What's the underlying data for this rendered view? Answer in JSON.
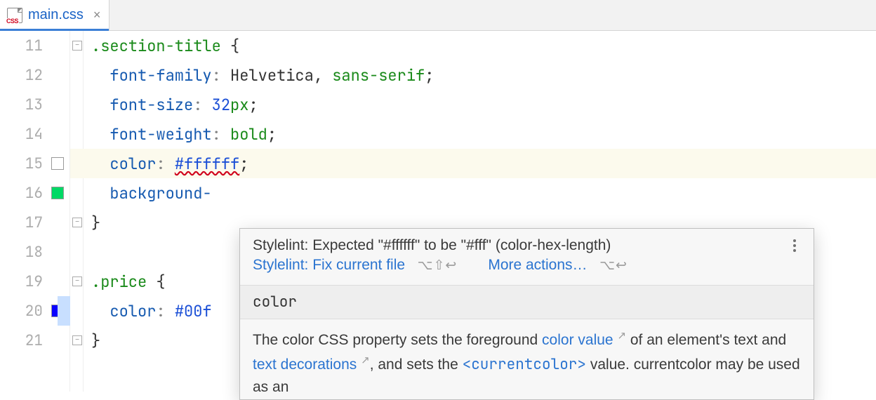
{
  "tab": {
    "filename": "main.css",
    "icon_badge": "CSS"
  },
  "gutter": {
    "start": 11,
    "end": 21,
    "swatches": {
      "15": "#ffffff",
      "16": "#00d965",
      "20": "#0800ff"
    }
  },
  "code": {
    "lines": [
      {
        "n": 11,
        "tokens": [
          {
            "t": ".section-title",
            "c": "t-sel"
          },
          {
            "t": " {",
            "c": "t-punc"
          }
        ],
        "fold": "open"
      },
      {
        "n": 12,
        "tokens": [
          {
            "t": "  ",
            "c": ""
          },
          {
            "t": "font-family",
            "c": "t-prop"
          },
          {
            "t": ": ",
            "c": "t-col"
          },
          {
            "t": "Helvetica",
            "c": "t-str"
          },
          {
            "t": ", ",
            "c": "t-punc"
          },
          {
            "t": "sans-serif",
            "c": "t-kw2"
          },
          {
            "t": ";",
            "c": "t-punc"
          }
        ]
      },
      {
        "n": 13,
        "tokens": [
          {
            "t": "  ",
            "c": ""
          },
          {
            "t": "font-size",
            "c": "t-prop"
          },
          {
            "t": ": ",
            "c": "t-col"
          },
          {
            "t": "32",
            "c": "t-num"
          },
          {
            "t": "px",
            "c": "t-unit"
          },
          {
            "t": ";",
            "c": "t-punc"
          }
        ]
      },
      {
        "n": 14,
        "tokens": [
          {
            "t": "  ",
            "c": ""
          },
          {
            "t": "font-weight",
            "c": "t-prop"
          },
          {
            "t": ": ",
            "c": "t-col"
          },
          {
            "t": "bold",
            "c": "t-kw2"
          },
          {
            "t": ";",
            "c": "t-punc"
          }
        ]
      },
      {
        "n": 15,
        "hl": true,
        "tokens": [
          {
            "t": "  ",
            "c": ""
          },
          {
            "t": "color",
            "c": "t-prop"
          },
          {
            "t": ": ",
            "c": "t-col"
          },
          {
            "t": "#ffffff",
            "c": "t-hex t-warn"
          },
          {
            "t": ";",
            "c": "t-punc"
          }
        ]
      },
      {
        "n": 16,
        "tokens": [
          {
            "t": "  ",
            "c": ""
          },
          {
            "t": "background-",
            "c": "t-prop"
          }
        ]
      },
      {
        "n": 17,
        "tokens": [
          {
            "t": "}",
            "c": "t-punc"
          }
        ],
        "fold": "close"
      },
      {
        "n": 18,
        "tokens": []
      },
      {
        "n": 19,
        "tokens": [
          {
            "t": ".price",
            "c": "t-sel"
          },
          {
            "t": " {",
            "c": "t-punc"
          }
        ],
        "fold": "open"
      },
      {
        "n": 20,
        "sel": true,
        "tokens": [
          {
            "t": "  ",
            "c": ""
          },
          {
            "t": "color",
            "c": "t-prop"
          },
          {
            "t": ": ",
            "c": "t-col"
          },
          {
            "t": "#00f",
            "c": "t-hex"
          }
        ]
      },
      {
        "n": 21,
        "tokens": [
          {
            "t": "}",
            "c": "t-punc"
          }
        ],
        "fold": "close"
      }
    ]
  },
  "popup": {
    "message": "Stylelint: Expected \"#ffffff\" to be \"#fff\" (color-hex-length)",
    "fix_label": "Stylelint: Fix current file",
    "fix_shortcut": "⌥⇧↩",
    "more_label": "More actions…",
    "more_shortcut": "⌥↩",
    "doc_title": "color",
    "doc_body_parts": {
      "p1": "The color CSS property sets the foreground ",
      "link1": "color value",
      "p2": " of an element's text and ",
      "link2": "text decorations",
      "p3": ", and sets the ",
      "cc": "<currentcolor>",
      "p4": " value. currentcolor may be used as an"
    }
  }
}
